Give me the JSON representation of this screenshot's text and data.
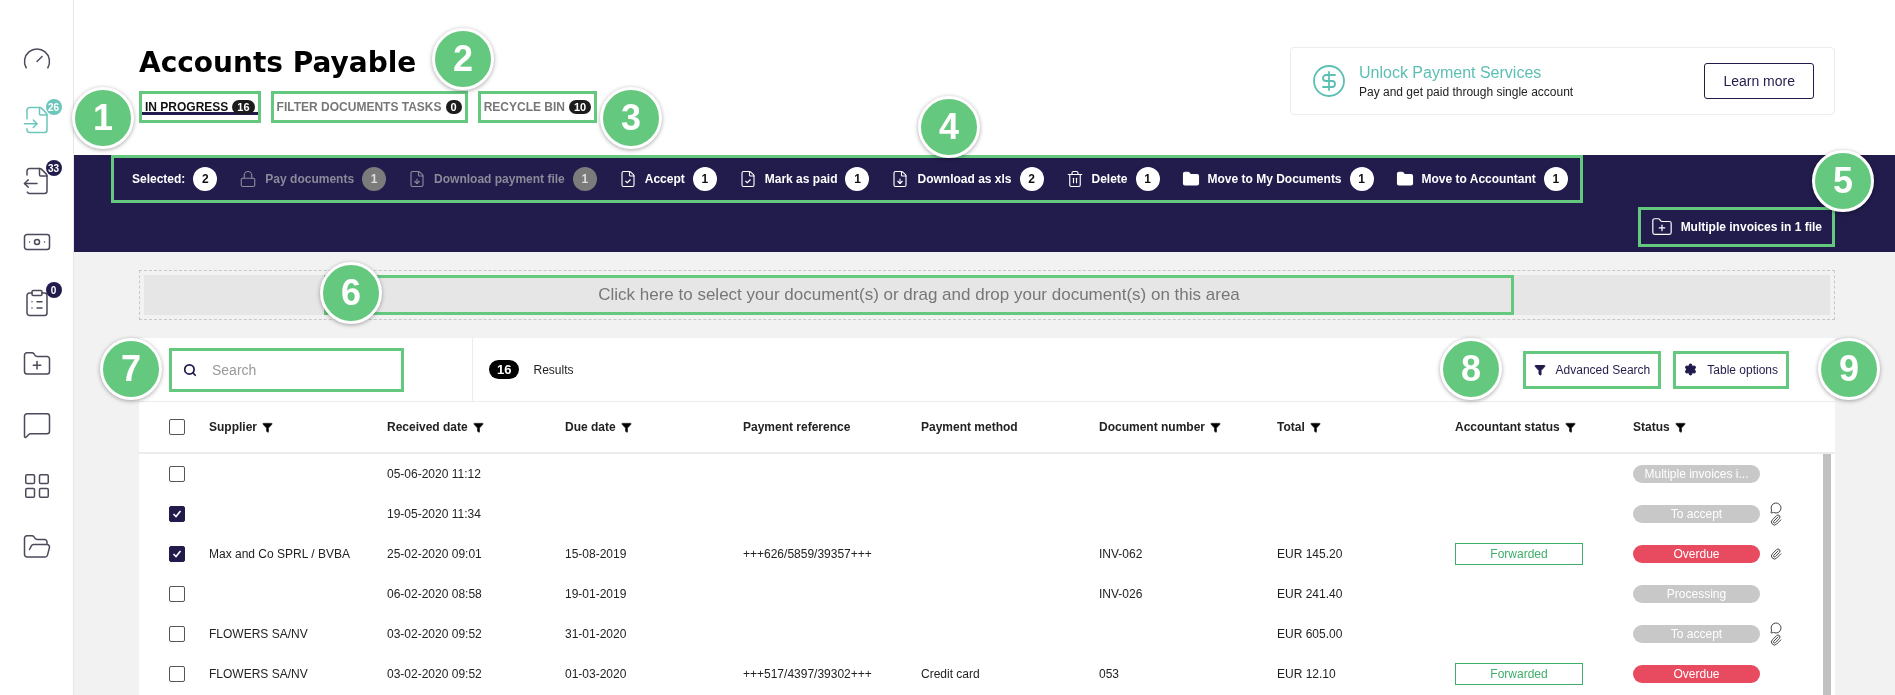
{
  "sidebar": {
    "items": [
      {
        "selected": false
      },
      {
        "selected": true,
        "badge": "26"
      },
      {
        "selected": false,
        "badge": "33"
      },
      {
        "selected": false
      },
      {
        "selected": false,
        "badge": "0"
      },
      {
        "selected": false
      },
      {
        "selected": false
      },
      {
        "selected": false
      },
      {
        "selected": false
      }
    ]
  },
  "title": "Accounts Payable",
  "tabs": [
    {
      "label": "IN PROGRESS",
      "count": "16",
      "selected": true
    },
    {
      "label": "FILTER DOCUMENTS TASKS",
      "count": "0",
      "selected": false
    },
    {
      "label": "RECYCLE BIN",
      "count": "10",
      "selected": false
    }
  ],
  "promo": {
    "title": "Unlock Payment Services",
    "subtitle": "Pay and get paid through single account",
    "button": "Learn more"
  },
  "toolbar": {
    "selected_label": "Selected:",
    "selected_count": "2",
    "actions": [
      {
        "label": "Pay documents",
        "count": "1",
        "disabled": true
      },
      {
        "label": "Download payment file",
        "count": "1",
        "disabled": true
      },
      {
        "label": "Accept",
        "count": "1",
        "disabled": false
      },
      {
        "label": "Mark as paid",
        "count": "1",
        "disabled": false
      },
      {
        "label": "Download as xls",
        "count": "2",
        "disabled": false
      },
      {
        "label": "Delete",
        "count": "1",
        "disabled": false
      },
      {
        "label": "Move to My Documents",
        "count": "1",
        "disabled": false
      },
      {
        "label": "Move to Accountant",
        "count": "1",
        "disabled": false
      }
    ],
    "multi_file": "Multiple invoices in 1 file"
  },
  "dropzone": "Click here to select your document(s) or drag and drop your document(s) on this area",
  "search": {
    "placeholder": "Search"
  },
  "results": {
    "count": "16",
    "label": "Results"
  },
  "advanced_search": "Advanced Search",
  "table_options": "Table options",
  "table": {
    "columns": [
      {
        "label": "Supplier",
        "filter": true
      },
      {
        "label": "Received date",
        "filter": true
      },
      {
        "label": "Due date",
        "filter": true
      },
      {
        "label": "Payment reference",
        "filter": false
      },
      {
        "label": "Payment method",
        "filter": false
      },
      {
        "label": "Document number",
        "filter": true
      },
      {
        "label": "Total",
        "filter": true
      },
      {
        "label": "Accountant status",
        "filter": true
      },
      {
        "label": "Status",
        "filter": true
      }
    ],
    "header_checked": false,
    "rows": [
      {
        "checked": false,
        "supplier": "",
        "received": "05-06-2020 11:12",
        "due": "",
        "reference": "",
        "method": "",
        "number": "",
        "total": "",
        "accountant": "",
        "status": {
          "label": "Multiple invoices i...",
          "color": "#c8c8c8"
        },
        "comment": false,
        "attachment": false
      },
      {
        "checked": true,
        "supplier": "",
        "received": "19-05-2020 11:34",
        "due": "",
        "reference": "",
        "method": "",
        "number": "",
        "total": "",
        "accountant": "",
        "status": {
          "label": "To accept",
          "color": "#c8c8c8"
        },
        "comment": true,
        "attachment": true
      },
      {
        "checked": true,
        "supplier": "Max and Co SPRL / BVBA",
        "received": "25-02-2020 09:01",
        "due": "15-08-2019",
        "reference": "+++626/5859/39357+++",
        "method": "",
        "number": "INV-062",
        "total": "EUR 145.20",
        "accountant": "Forwarded",
        "status": {
          "label": "Overdue",
          "color": "#e84a5f"
        },
        "comment": false,
        "attachment": true
      },
      {
        "checked": false,
        "supplier": "",
        "received": "06-02-2020 08:58",
        "due": "19-01-2019",
        "reference": "",
        "method": "",
        "number": "INV-026",
        "total": "EUR 241.40",
        "accountant": "",
        "status": {
          "label": "Processing",
          "color": "#c8c8c8"
        },
        "comment": false,
        "attachment": false
      },
      {
        "checked": false,
        "supplier": "FLOWERS SA/NV",
        "received": "03-02-2020 09:52",
        "due": "31-01-2020",
        "reference": "",
        "method": "",
        "number": "",
        "total": "EUR 605.00",
        "accountant": "",
        "status": {
          "label": "To accept",
          "color": "#c8c8c8"
        },
        "comment": true,
        "attachment": true
      },
      {
        "checked": false,
        "supplier": "FLOWERS SA/NV",
        "received": "03-02-2020 09:52",
        "due": "01-03-2020",
        "reference": "+++517/4397/39302+++",
        "method": "Credit card",
        "number": "053",
        "total": "EUR 12.10",
        "accountant": "Forwarded",
        "status": {
          "label": "Overdue",
          "color": "#e84a5f"
        },
        "comment": false,
        "attachment": false
      }
    ]
  },
  "callouts": [
    {
      "number": "1"
    },
    {
      "number": "2"
    },
    {
      "number": "3"
    },
    {
      "number": "4"
    },
    {
      "number": "5"
    },
    {
      "number": "6"
    },
    {
      "number": "7"
    },
    {
      "number": "8"
    },
    {
      "number": "9"
    }
  ]
}
